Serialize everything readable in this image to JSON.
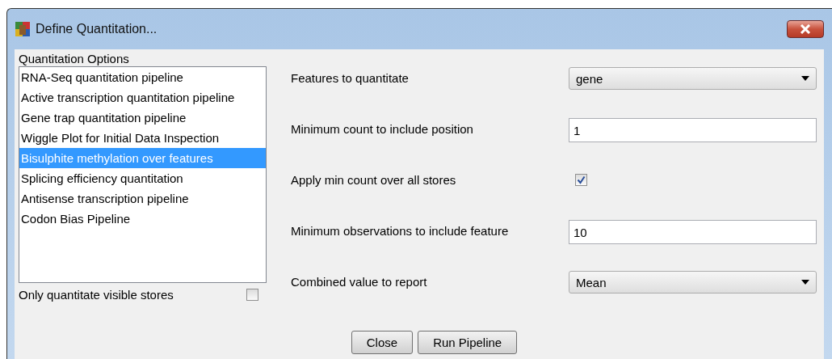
{
  "window": {
    "title": "Define Quantitation..."
  },
  "options": {
    "label": "Quantitation Options",
    "items": [
      {
        "label": "RNA-Seq quantitation pipeline",
        "selected": false
      },
      {
        "label": "Active transcription quantitation pipeline",
        "selected": false
      },
      {
        "label": "Gene trap quantitation pipeline",
        "selected": false
      },
      {
        "label": "Wiggle Plot for Initial Data Inspection",
        "selected": false
      },
      {
        "label": "Bisulphite methylation over features",
        "selected": true
      },
      {
        "label": "Splicing efficiency quantitation",
        "selected": false
      },
      {
        "label": "Antisense transcription pipeline",
        "selected": false
      },
      {
        "label": "Codon Bias Pipeline",
        "selected": false
      }
    ]
  },
  "visible_only": {
    "label": "Only quantitate visible stores",
    "checked": false
  },
  "settings": [
    {
      "kind": "dropdown",
      "label": "Features to quantitate",
      "value": "gene"
    },
    {
      "kind": "text",
      "label": "Minimum count to include position",
      "value": "1"
    },
    {
      "kind": "checkbox",
      "label": "Apply min count over all stores",
      "checked": true
    },
    {
      "kind": "text",
      "label": "Minimum observations to include feature",
      "value": "10"
    },
    {
      "kind": "dropdown",
      "label": "Combined value to report",
      "value": "Mean"
    }
  ],
  "buttons": [
    "Close",
    "Run Pipeline"
  ]
}
